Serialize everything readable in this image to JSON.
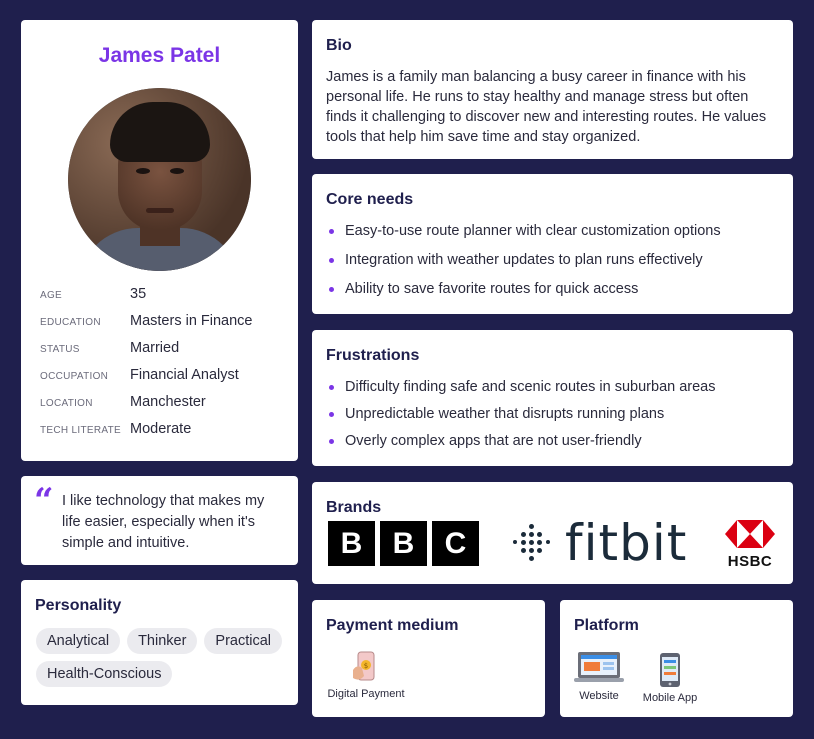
{
  "profile": {
    "name": "James Patel",
    "facts": [
      {
        "label": "AGE",
        "value": "35"
      },
      {
        "label": "EDUCATION",
        "value": "Masters in Finance"
      },
      {
        "label": "STATUS",
        "value": "Married"
      },
      {
        "label": "OCCUPATION",
        "value": "Financial Analyst"
      },
      {
        "label": "LOCATION",
        "value": "Manchester"
      },
      {
        "label": "TECH LITERATE",
        "value": "Moderate"
      }
    ]
  },
  "quote": {
    "text": "I like technology that makes my life easier, especially when it's simple and intuitive."
  },
  "personality": {
    "title": "Personality",
    "tags": [
      "Analytical",
      "Thinker",
      "Practical",
      "Health-Conscious"
    ]
  },
  "bio": {
    "title": "Bio",
    "text": "James is a family man balancing a busy career in finance with his personal life. He runs to stay healthy and manage stress but often finds it challenging to discover new and interesting routes. He values tools that help him save time and stay organized."
  },
  "needs": {
    "title": "Core needs",
    "items": [
      "Easy-to-use route planner with clear customization options",
      "Integration with weather updates to plan runs effectively",
      "Ability to save favorite routes for quick access"
    ]
  },
  "frustrations": {
    "title": "Frustrations",
    "items": [
      "Difficulty finding safe and scenic routes in suburban areas",
      "Unpredictable weather that disrupts running plans",
      "Overly complex apps that are not user-friendly"
    ]
  },
  "brands": {
    "title": "Brands",
    "bbc_letters": [
      "B",
      "B",
      "C"
    ],
    "fitbit": "fitbit",
    "hsbc": "HSBC"
  },
  "payment": {
    "title": "Payment medium",
    "items": [
      {
        "label": "Digital Payment",
        "icon": "phone-payment-icon"
      }
    ]
  },
  "platform": {
    "title": "Platform",
    "items": [
      {
        "label": "Website",
        "icon": "laptop-icon"
      },
      {
        "label": "Mobile App",
        "icon": "smartphone-icon"
      }
    ]
  },
  "colors": {
    "background": "#1f1f4d",
    "accent": "#7b35e6",
    "tag_bg": "#ebebef"
  }
}
